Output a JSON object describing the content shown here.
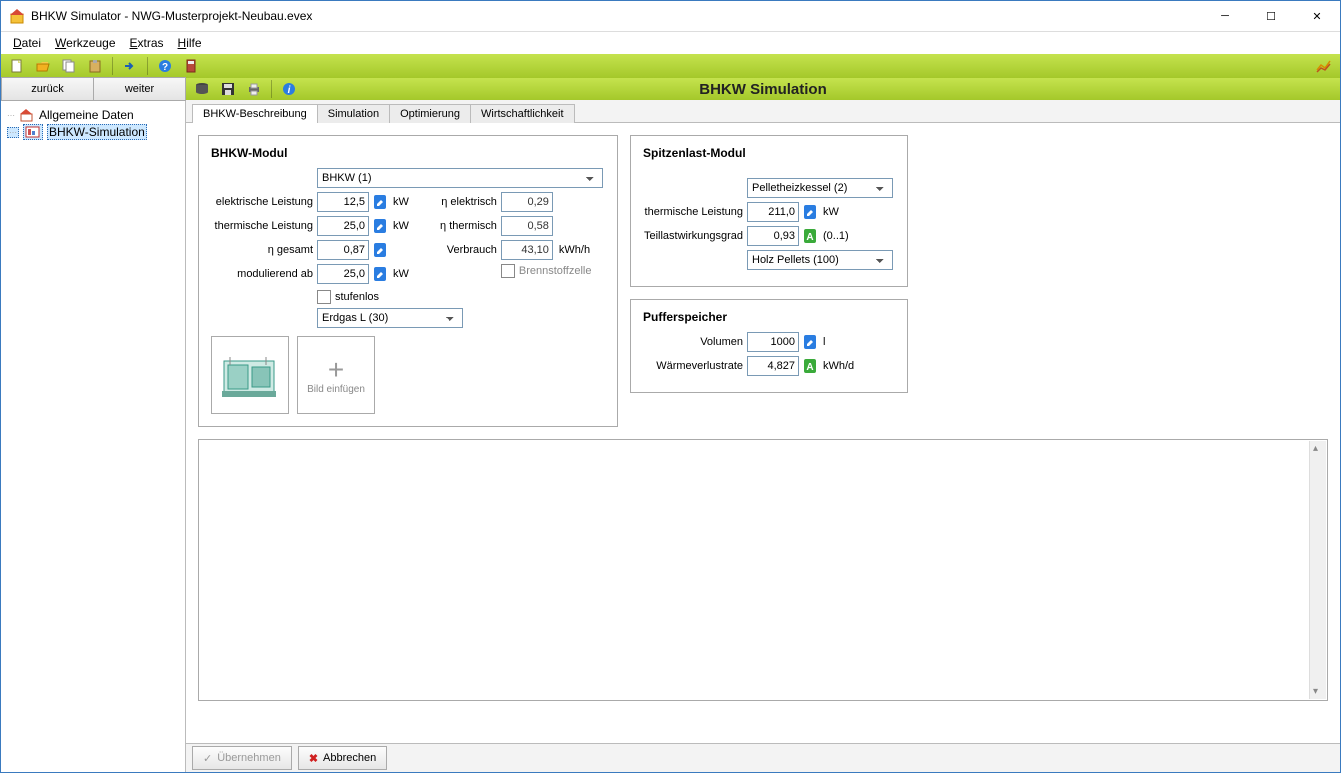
{
  "window": {
    "title": "BHKW Simulator - NWG-Musterprojekt-Neubau.evex"
  },
  "menubar": [
    {
      "k": "D",
      "rest": "atei"
    },
    {
      "k": "W",
      "rest": "erkzeuge"
    },
    {
      "k": "E",
      "rest": "xtras"
    },
    {
      "k": "H",
      "rest": "ilfe"
    }
  ],
  "nav": {
    "back": "zurück",
    "forward": "weiter"
  },
  "tree": [
    {
      "label": "Allgemeine Daten",
      "sel": false
    },
    {
      "label": "BHKW-Simulation",
      "sel": true
    }
  ],
  "header": {
    "title": "BHKW Simulation"
  },
  "tabs": [
    {
      "label": "BHKW-Beschreibung",
      "active": true
    },
    {
      "label": "Simulation"
    },
    {
      "label": "Optimierung"
    },
    {
      "label": "Wirtschaftlichkeit"
    }
  ],
  "bhkw": {
    "title": "BHKW-Modul",
    "select": "BHKW (1)",
    "rows_left": [
      {
        "label": "elektrische Leistung",
        "value": "12,5",
        "edit": true,
        "unit": "kW"
      },
      {
        "label": "thermische Leistung",
        "value": "25,0",
        "edit": true,
        "unit": "kW"
      },
      {
        "label": "η gesamt",
        "value": "0,87",
        "edit": true,
        "unit": ""
      },
      {
        "label": "modulierend ab",
        "value": "25,0",
        "edit": true,
        "unit": "kW"
      }
    ],
    "rows_right": [
      {
        "label": "η elektrisch",
        "value": "0,29",
        "edit": false,
        "unit": ""
      },
      {
        "label": "η thermisch",
        "value": "0,58",
        "edit": false,
        "unit": ""
      },
      {
        "label": "Verbrauch",
        "value": "43,10",
        "edit": false,
        "unit": "kWh/h"
      }
    ],
    "stufenlos": "stufenlos",
    "brennstoffzelle": "Brennstoffzelle",
    "fuel": "Erdgas L (30)",
    "addimg": "Bild einfügen"
  },
  "spitze": {
    "title": "Spitzenlast-Modul",
    "select": "Pelletheizkessel (2)",
    "rows": [
      {
        "label": "thermische Leistung",
        "value": "211,0",
        "edit": true,
        "unit": "kW",
        "hint": ""
      },
      {
        "label": "Teillastwirkungsgrad",
        "value": "0,93",
        "auto": true,
        "unit": "",
        "hint": "(0..1)"
      }
    ],
    "fuel": "Holz Pellets (100)"
  },
  "puffer": {
    "title": "Pufferspeicher",
    "rows": [
      {
        "label": "Volumen",
        "value": "1000",
        "edit": true,
        "unit": "l"
      },
      {
        "label": "Wärmeverlustrate",
        "value": "4,827",
        "auto": true,
        "unit": "kWh/d"
      }
    ]
  },
  "footer": {
    "apply": "Übernehmen",
    "cancel": "Abbrechen"
  }
}
